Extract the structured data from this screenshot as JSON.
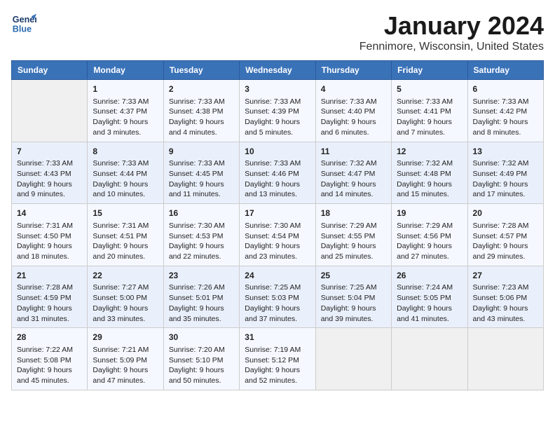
{
  "header": {
    "logo_line1": "General",
    "logo_line2": "Blue",
    "month_title": "January 2024",
    "location": "Fennimore, Wisconsin, United States"
  },
  "days_of_week": [
    "Sunday",
    "Monday",
    "Tuesday",
    "Wednesday",
    "Thursday",
    "Friday",
    "Saturday"
  ],
  "weeks": [
    [
      {
        "day": "",
        "content": ""
      },
      {
        "day": "1",
        "content": "Sunrise: 7:33 AM\nSunset: 4:37 PM\nDaylight: 9 hours\nand 3 minutes."
      },
      {
        "day": "2",
        "content": "Sunrise: 7:33 AM\nSunset: 4:38 PM\nDaylight: 9 hours\nand 4 minutes."
      },
      {
        "day": "3",
        "content": "Sunrise: 7:33 AM\nSunset: 4:39 PM\nDaylight: 9 hours\nand 5 minutes."
      },
      {
        "day": "4",
        "content": "Sunrise: 7:33 AM\nSunset: 4:40 PM\nDaylight: 9 hours\nand 6 minutes."
      },
      {
        "day": "5",
        "content": "Sunrise: 7:33 AM\nSunset: 4:41 PM\nDaylight: 9 hours\nand 7 minutes."
      },
      {
        "day": "6",
        "content": "Sunrise: 7:33 AM\nSunset: 4:42 PM\nDaylight: 9 hours\nand 8 minutes."
      }
    ],
    [
      {
        "day": "7",
        "content": "Sunrise: 7:33 AM\nSunset: 4:43 PM\nDaylight: 9 hours\nand 9 minutes."
      },
      {
        "day": "8",
        "content": "Sunrise: 7:33 AM\nSunset: 4:44 PM\nDaylight: 9 hours\nand 10 minutes."
      },
      {
        "day": "9",
        "content": "Sunrise: 7:33 AM\nSunset: 4:45 PM\nDaylight: 9 hours\nand 11 minutes."
      },
      {
        "day": "10",
        "content": "Sunrise: 7:33 AM\nSunset: 4:46 PM\nDaylight: 9 hours\nand 13 minutes."
      },
      {
        "day": "11",
        "content": "Sunrise: 7:32 AM\nSunset: 4:47 PM\nDaylight: 9 hours\nand 14 minutes."
      },
      {
        "day": "12",
        "content": "Sunrise: 7:32 AM\nSunset: 4:48 PM\nDaylight: 9 hours\nand 15 minutes."
      },
      {
        "day": "13",
        "content": "Sunrise: 7:32 AM\nSunset: 4:49 PM\nDaylight: 9 hours\nand 17 minutes."
      }
    ],
    [
      {
        "day": "14",
        "content": "Sunrise: 7:31 AM\nSunset: 4:50 PM\nDaylight: 9 hours\nand 18 minutes."
      },
      {
        "day": "15",
        "content": "Sunrise: 7:31 AM\nSunset: 4:51 PM\nDaylight: 9 hours\nand 20 minutes."
      },
      {
        "day": "16",
        "content": "Sunrise: 7:30 AM\nSunset: 4:53 PM\nDaylight: 9 hours\nand 22 minutes."
      },
      {
        "day": "17",
        "content": "Sunrise: 7:30 AM\nSunset: 4:54 PM\nDaylight: 9 hours\nand 23 minutes."
      },
      {
        "day": "18",
        "content": "Sunrise: 7:29 AM\nSunset: 4:55 PM\nDaylight: 9 hours\nand 25 minutes."
      },
      {
        "day": "19",
        "content": "Sunrise: 7:29 AM\nSunset: 4:56 PM\nDaylight: 9 hours\nand 27 minutes."
      },
      {
        "day": "20",
        "content": "Sunrise: 7:28 AM\nSunset: 4:57 PM\nDaylight: 9 hours\nand 29 minutes."
      }
    ],
    [
      {
        "day": "21",
        "content": "Sunrise: 7:28 AM\nSunset: 4:59 PM\nDaylight: 9 hours\nand 31 minutes."
      },
      {
        "day": "22",
        "content": "Sunrise: 7:27 AM\nSunset: 5:00 PM\nDaylight: 9 hours\nand 33 minutes."
      },
      {
        "day": "23",
        "content": "Sunrise: 7:26 AM\nSunset: 5:01 PM\nDaylight: 9 hours\nand 35 minutes."
      },
      {
        "day": "24",
        "content": "Sunrise: 7:25 AM\nSunset: 5:03 PM\nDaylight: 9 hours\nand 37 minutes."
      },
      {
        "day": "25",
        "content": "Sunrise: 7:25 AM\nSunset: 5:04 PM\nDaylight: 9 hours\nand 39 minutes."
      },
      {
        "day": "26",
        "content": "Sunrise: 7:24 AM\nSunset: 5:05 PM\nDaylight: 9 hours\nand 41 minutes."
      },
      {
        "day": "27",
        "content": "Sunrise: 7:23 AM\nSunset: 5:06 PM\nDaylight: 9 hours\nand 43 minutes."
      }
    ],
    [
      {
        "day": "28",
        "content": "Sunrise: 7:22 AM\nSunset: 5:08 PM\nDaylight: 9 hours\nand 45 minutes."
      },
      {
        "day": "29",
        "content": "Sunrise: 7:21 AM\nSunset: 5:09 PM\nDaylight: 9 hours\nand 47 minutes."
      },
      {
        "day": "30",
        "content": "Sunrise: 7:20 AM\nSunset: 5:10 PM\nDaylight: 9 hours\nand 50 minutes."
      },
      {
        "day": "31",
        "content": "Sunrise: 7:19 AM\nSunset: 5:12 PM\nDaylight: 9 hours\nand 52 minutes."
      },
      {
        "day": "",
        "content": ""
      },
      {
        "day": "",
        "content": ""
      },
      {
        "day": "",
        "content": ""
      }
    ]
  ]
}
